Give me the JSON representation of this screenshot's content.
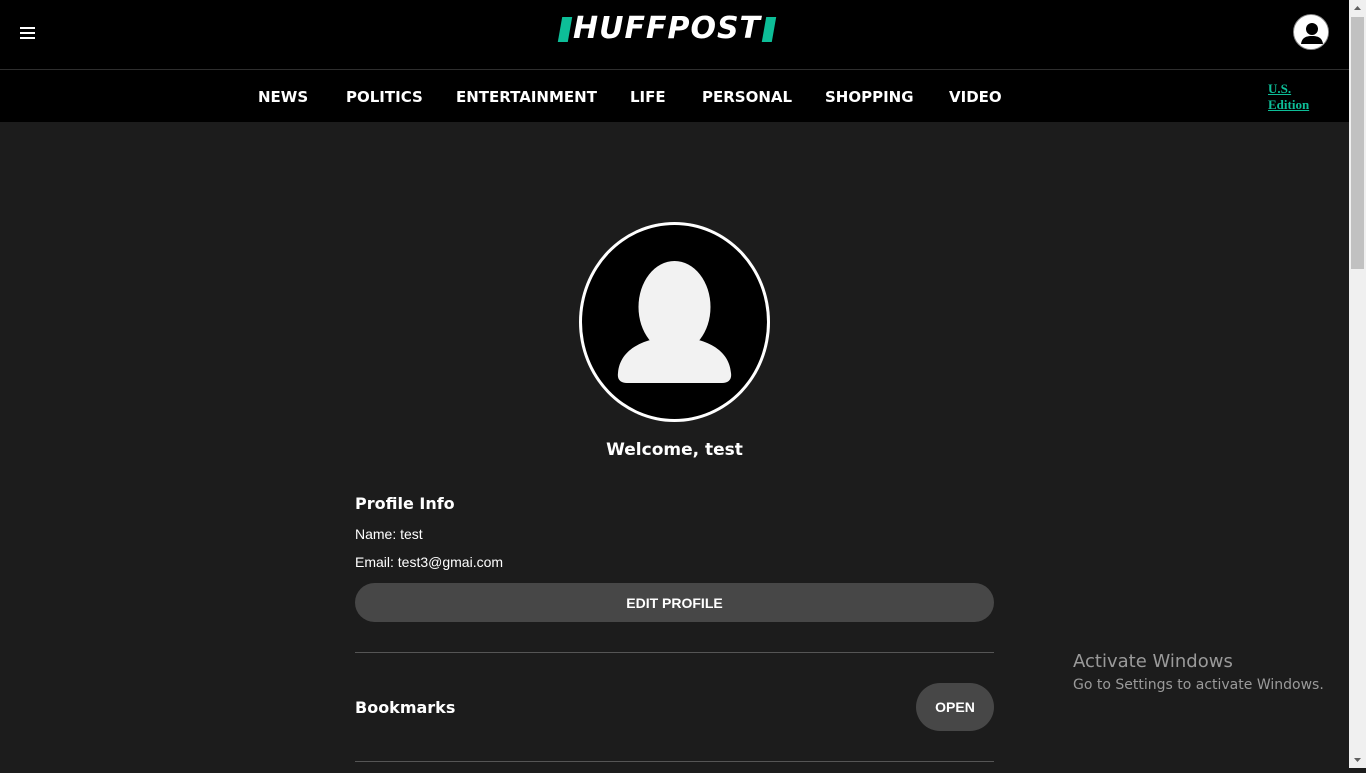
{
  "header": {
    "logo_text": "HUFFPOST",
    "menu_icon": "hamburger-menu-icon",
    "user_icon": "user-account-icon"
  },
  "nav": {
    "items": [
      "NEWS",
      "POLITICS",
      "ENTERTAINMENT",
      "LIFE",
      "PERSONAL",
      "SHOPPING",
      "VIDEO"
    ],
    "edition_line1": "U.S.",
    "edition_line2": "Edition"
  },
  "profile": {
    "welcome": "Welcome, test",
    "info_title": "Profile Info",
    "name_line": "Name: test",
    "email_line": "Email: test3@gmai.com",
    "edit_button": "EDIT PROFILE",
    "bookmarks_title": "Bookmarks",
    "open_button": "OPEN"
  },
  "watermark": {
    "title": "Activate Windows",
    "subtitle": "Go to Settings to activate Windows."
  },
  "colors": {
    "brand_accent": "#0dbe98",
    "page_bg": "#1c1c1c",
    "header_bg": "#000000",
    "button_bg": "#474747"
  }
}
